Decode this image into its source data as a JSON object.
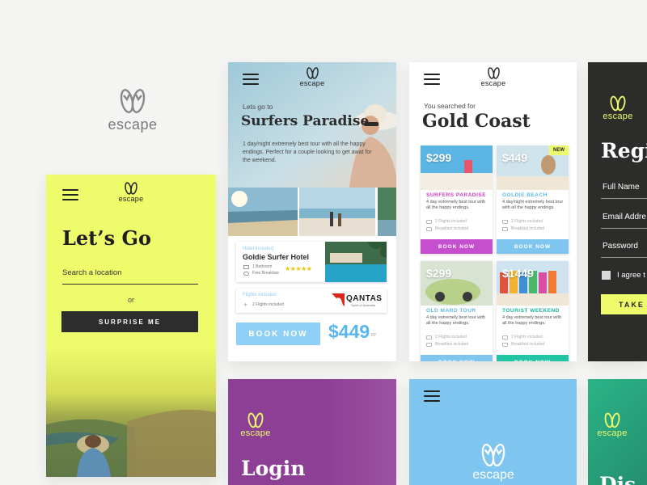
{
  "brand": {
    "word": "escape"
  },
  "screen_letsgo": {
    "title": "Let’s Go",
    "search_placeholder": "Search a location",
    "or_text": "or",
    "surprise_button": "SURPRISE ME"
  },
  "screen_surfers": {
    "kicker": "Lets go to",
    "title": "Surfers Paradise",
    "description": "1 day/night extremely best tour with all the happy endings. Perfect for a couple looking to get awat for the weekend.",
    "hotel_included_label": "Hotel included",
    "hotel_name": "Goldie Surfer Hotel",
    "hotel_details": [
      "1 Bedroom",
      "Free Breakfast"
    ],
    "hotel_rating_stars": 5,
    "flights_included_label": "Flights included",
    "flights_detail": "2 Flights included",
    "airline_name": "QANTAS",
    "airline_tagline": "Spirit of Australia",
    "book_button": "BOOK NOW",
    "price": "$449",
    "price_suffix": "pp"
  },
  "screen_goldcoast": {
    "kicker": "You searched for",
    "title": "Gold Coast",
    "cards": [
      {
        "price": "$299",
        "name": "SURFERS PARADISE",
        "desc": "4 day extremely best tour with all the happy endings.",
        "f1": "2 Flights included",
        "f2": "Breakfast included",
        "button": "BOOK NOW",
        "badge": "",
        "accent": "#d23cc0",
        "btn_color": "#c64fd0"
      },
      {
        "price": "$449",
        "name": "GOLDIE BEACH",
        "desc": "4 day/night extremely best tour with all the happy endings.",
        "f1": "2 Flights included",
        "f2": "Breakfast included",
        "button": "BOOK NOW",
        "badge": "NEW",
        "accent": "#5fb8e8",
        "btn_color": "#7ec6ef"
      },
      {
        "price": "$299",
        "name": "OLD MARD TOUR",
        "desc": "4 day extremely best tour with all the happy endings.",
        "f1": "2 Flights included",
        "f2": "Breakfast included",
        "button": "BOOK NOW",
        "badge": "",
        "accent": "#5fb8e8",
        "btn_color": "#7ec6ef"
      },
      {
        "price": "$1449",
        "name": "TOURIST WEEKEND",
        "desc": "4 day extremely best tour with all the happy endings.",
        "f1": "2 Flights included",
        "f2": "Breakfast included",
        "button": "BOOK NOW",
        "badge": "",
        "accent": "#1bb59a",
        "btn_color": "#22c4a6"
      }
    ]
  },
  "screen_register": {
    "title": "Regis",
    "fields": [
      "Full Name",
      "Email Addre",
      "Password"
    ],
    "agree_text": "I agree t",
    "button": "TAKE M"
  },
  "screen_login": {
    "title": "Login"
  },
  "screen_green": {
    "title": "Dis"
  },
  "colors": {
    "yellow": "#eefb6b",
    "purple": "#8d3f96",
    "blue": "#7ec6ef",
    "dark": "#2c2c2a",
    "green": "#27ad85",
    "book_blue": "#8fd0f6",
    "price_blue": "#5ab7ee"
  }
}
